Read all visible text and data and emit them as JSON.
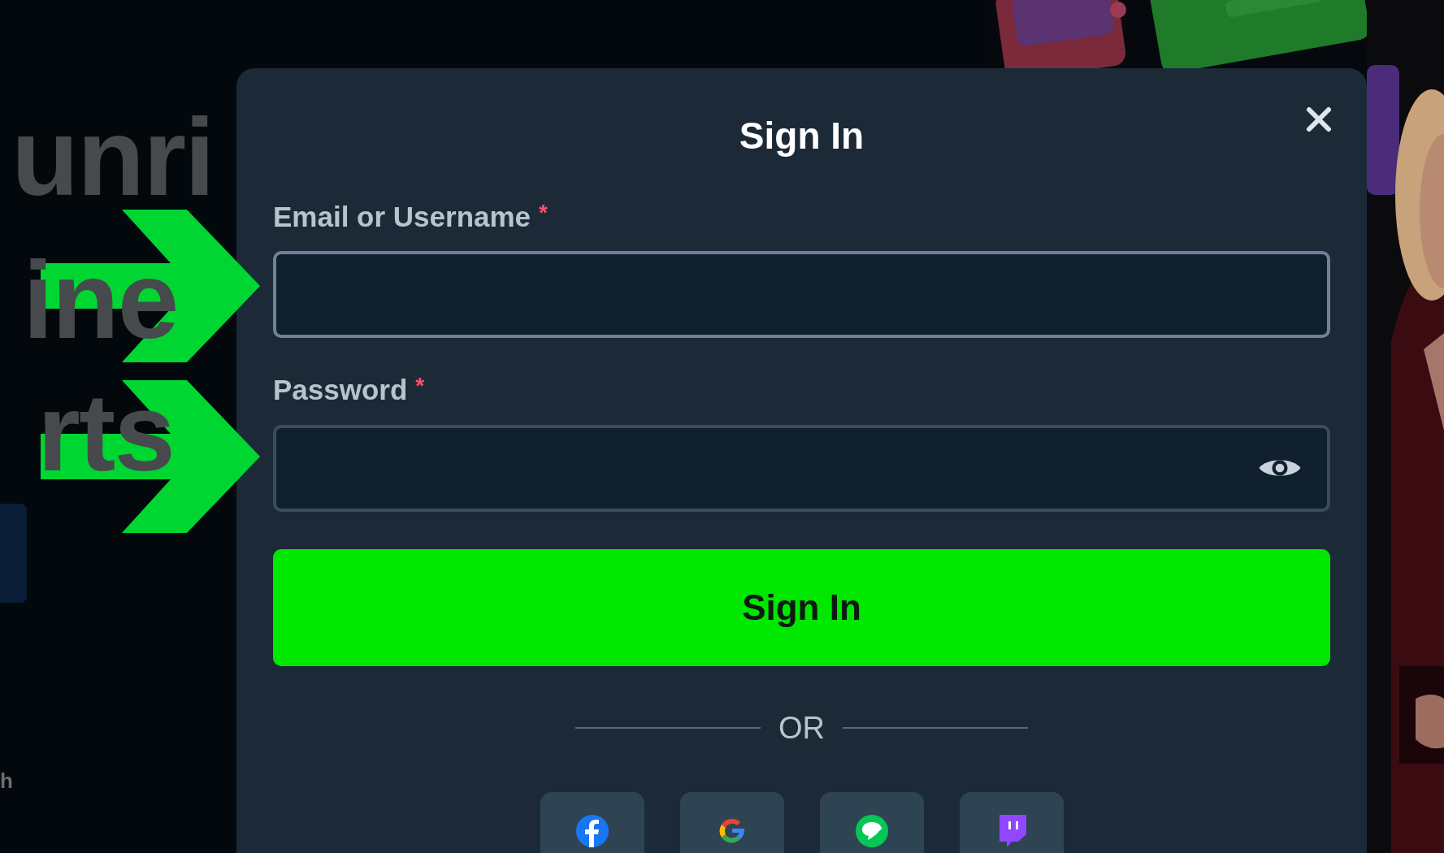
{
  "background": {
    "headline_lines": [
      "unri",
      "ine",
      "rts"
    ],
    "footer_text": "h"
  },
  "annotations": [
    {
      "kind": "arrow"
    },
    {
      "kind": "arrow"
    }
  ],
  "dialog": {
    "title": "Sign In",
    "fields": [
      {
        "label": "Email or Username",
        "required_mark": "*",
        "kind": "text",
        "focused": true
      },
      {
        "label": "Password",
        "required_mark": "*",
        "kind": "password",
        "focused": false
      }
    ],
    "submit": "Sign In",
    "divider": "OR",
    "social": [
      {
        "kind": "facebook"
      },
      {
        "kind": "google"
      },
      {
        "kind": "line"
      },
      {
        "kind": "twitch"
      }
    ]
  }
}
